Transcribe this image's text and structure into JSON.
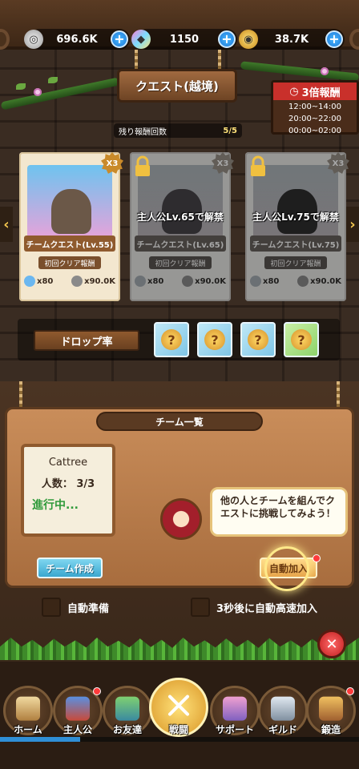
{
  "currencies": [
    {
      "icon": "silver-coin-icon",
      "value": "696.6K"
    },
    {
      "icon": "diamond-gem-icon",
      "value": "1150"
    },
    {
      "icon": "gold-medal-icon",
      "value": "38.7K"
    }
  ],
  "title": "クエスト(越境)",
  "triple_reward": {
    "label": "3倍報酬",
    "times": [
      "12:00~14:00",
      "20:00~22:00",
      "00:00~02:00"
    ]
  },
  "remaining": {
    "label": "残り報酬回数",
    "count": "5/5"
  },
  "quests": [
    {
      "name": "チームクエスト(Lv.55)",
      "first_clear": "初回クリア報酬",
      "multiplier": "X3",
      "locked": false,
      "unlock_text": "",
      "rewards": [
        {
          "icon": "gem-icon",
          "value": "x80"
        },
        {
          "icon": "silver-coin-icon",
          "value": "x90.0K"
        }
      ]
    },
    {
      "name": "チームクエスト(Lv.65)",
      "first_clear": "初回クリア報酬",
      "multiplier": "X3",
      "locked": true,
      "unlock_text": "主人公Lv.65で解禁",
      "rewards": [
        {
          "icon": "gem-icon",
          "value": "x80"
        },
        {
          "icon": "silver-coin-icon",
          "value": "x90.0K"
        }
      ]
    },
    {
      "name": "チームクエスト(Lv.75)",
      "first_clear": "初回クリア報酬",
      "multiplier": "X3",
      "locked": true,
      "unlock_text": "主人公Lv.75で解禁",
      "rewards": [
        {
          "icon": "gem-icon",
          "value": "x80"
        },
        {
          "icon": "silver-coin-icon",
          "value": "x90.0K"
        }
      ]
    }
  ],
  "drop_rate": {
    "label": "ドロップ率",
    "slots": [
      "?",
      "?",
      "?",
      "?"
    ]
  },
  "team_panel": {
    "header": "チーム一覧",
    "team": {
      "name": "Cattree",
      "members": "人数： 3/3",
      "status": "進行中..."
    },
    "speech": "他の人とチームを組んでクエストに挑戦してみよう！",
    "create_button": "チーム作成",
    "auto_join_button": "自動加入",
    "auto_prepare_label": "自動準備",
    "auto_fast_join_label": "3秒後に自動高速加入"
  },
  "close_label": "✕",
  "nav": [
    {
      "label": "ホーム",
      "icon": "home-icon"
    },
    {
      "label": "主人公",
      "icon": "hero-icon"
    },
    {
      "label": "お友達",
      "icon": "friends-icon"
    },
    {
      "label": "戦闘",
      "icon": "crossed-swords-icon"
    },
    {
      "label": "サポート",
      "icon": "support-icon"
    },
    {
      "label": "ギルド",
      "icon": "guild-castle-icon"
    },
    {
      "label": "鍛造",
      "icon": "forge-icon"
    }
  ],
  "colors": {
    "accent": "#1a78d8",
    "gold": "#e6a44a",
    "danger": "#c11d1d"
  }
}
